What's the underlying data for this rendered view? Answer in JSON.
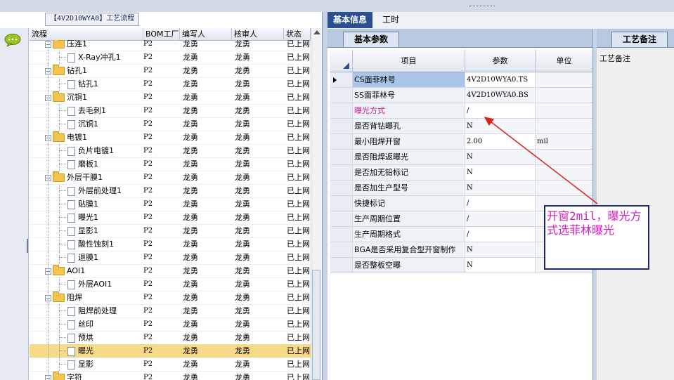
{
  "left_panel": {
    "process_title": "【4V2D10WYA0】工艺流程",
    "columns": [
      "流程",
      "BOM工厂",
      "编写人",
      "核审人",
      "状态"
    ],
    "rows": [
      {
        "name": "压连1",
        "type": "folder",
        "bom": "P2",
        "author": "龙勇",
        "reviewer": "龙勇",
        "status": "已上网"
      },
      {
        "name": "X-Ray冲孔1",
        "type": "doc",
        "bom": "P2",
        "author": "龙勇",
        "reviewer": "龙勇",
        "status": "已上网"
      },
      {
        "name": "钻孔1",
        "type": "folder",
        "bom": "P2",
        "author": "龙勇",
        "reviewer": "龙勇",
        "status": "已上网"
      },
      {
        "name": "钻孔1",
        "type": "doc",
        "bom": "P2",
        "author": "龙勇",
        "reviewer": "龙勇",
        "status": "已上网"
      },
      {
        "name": "沉铜1",
        "type": "folder",
        "bom": "P2",
        "author": "龙勇",
        "reviewer": "龙勇",
        "status": "已上网"
      },
      {
        "name": "去毛刺1",
        "type": "doc",
        "bom": "P2",
        "author": "龙勇",
        "reviewer": "龙勇",
        "status": "已上网"
      },
      {
        "name": "沉铜1",
        "type": "doc",
        "bom": "P2",
        "author": "龙勇",
        "reviewer": "龙勇",
        "status": "已上网"
      },
      {
        "name": "电镀1",
        "type": "folder",
        "bom": "P2",
        "author": "龙勇",
        "reviewer": "龙勇",
        "status": "已上网"
      },
      {
        "name": "负片电镀1",
        "type": "doc",
        "bom": "P2",
        "author": "龙勇",
        "reviewer": "龙勇",
        "status": "已上网"
      },
      {
        "name": "磨板1",
        "type": "doc",
        "bom": "P2",
        "author": "龙勇",
        "reviewer": "龙勇",
        "status": "已上网"
      },
      {
        "name": "外层干膜1",
        "type": "folder",
        "bom": "P2",
        "author": "龙勇",
        "reviewer": "龙勇",
        "status": "已上网"
      },
      {
        "name": "外层前处理1",
        "type": "doc",
        "bom": "P2",
        "author": "龙勇",
        "reviewer": "龙勇",
        "status": "已上网"
      },
      {
        "name": "贴膜1",
        "type": "doc",
        "bom": "P2",
        "author": "龙勇",
        "reviewer": "龙勇",
        "status": "已上网"
      },
      {
        "name": "曝光1",
        "type": "doc",
        "bom": "P2",
        "author": "龙勇",
        "reviewer": "龙勇",
        "status": "已上网"
      },
      {
        "name": "显影1",
        "type": "doc",
        "bom": "P2",
        "author": "龙勇",
        "reviewer": "龙勇",
        "status": "已上网"
      },
      {
        "name": "酸性蚀刻1",
        "type": "doc",
        "bom": "P2",
        "author": "龙勇",
        "reviewer": "龙勇",
        "status": "已上网"
      },
      {
        "name": "退膜1",
        "type": "doc",
        "bom": "P2",
        "author": "龙勇",
        "reviewer": "龙勇",
        "status": "已上网"
      },
      {
        "name": "AOI1",
        "type": "folder",
        "bom": "P2",
        "author": "龙勇",
        "reviewer": "龙勇",
        "status": "已上网"
      },
      {
        "name": "外层AOI1",
        "type": "doc",
        "bom": "P2",
        "author": "龙勇",
        "reviewer": "龙勇",
        "status": "已上网"
      },
      {
        "name": "阻焊",
        "type": "folder",
        "bom": "P2",
        "author": "龙勇",
        "reviewer": "龙勇",
        "status": "已上网"
      },
      {
        "name": "阻焊前处理",
        "type": "doc",
        "bom": "P2",
        "author": "龙勇",
        "reviewer": "龙勇",
        "status": "已上网"
      },
      {
        "name": "丝印",
        "type": "doc",
        "bom": "P2",
        "author": "龙勇",
        "reviewer": "龙勇",
        "status": "已上网"
      },
      {
        "name": "预烘",
        "type": "doc",
        "bom": "P2",
        "author": "龙勇",
        "reviewer": "龙勇",
        "status": "已上网"
      },
      {
        "name": "曝光",
        "type": "doc",
        "bom": "P2",
        "author": "龙勇",
        "reviewer": "龙勇",
        "status": "已上网",
        "selected": true
      },
      {
        "name": "显影",
        "type": "doc",
        "bom": "P2",
        "author": "龙勇",
        "reviewer": "龙勇",
        "status": "已上网"
      },
      {
        "name": "字符",
        "type": "folder",
        "bom": "P2",
        "author": "龙勇",
        "reviewer": "龙勇",
        "status": "已上网"
      }
    ]
  },
  "tabs": {
    "main": [
      "基本信息",
      "工时"
    ],
    "sub": "基本参数",
    "notes_tab": "工艺备注"
  },
  "param_table": {
    "headers": [
      "项目",
      "参数",
      "单位"
    ],
    "rows": [
      {
        "item": "CS面菲林号",
        "value": "4V2D10WYA0.TS",
        "unit": "",
        "current": true
      },
      {
        "item": "SS面菲林号",
        "value": "4V2D10WYA0.BS",
        "unit": ""
      },
      {
        "item": "曝光方式",
        "value": "/",
        "unit": "",
        "pink": true
      },
      {
        "item": "是否背钻曝孔",
        "value": "N",
        "unit": ""
      },
      {
        "item": "最小阻焊开窗",
        "value": "2.00",
        "unit": "mil"
      },
      {
        "item": "是否阻焊返曝光",
        "value": "N",
        "unit": ""
      },
      {
        "item": "是否加无铅标记",
        "value": "N",
        "unit": ""
      },
      {
        "item": "是否加生产型号",
        "value": "N",
        "unit": ""
      },
      {
        "item": "快捷标记",
        "value": "/",
        "unit": ""
      },
      {
        "item": "生产周期位置",
        "value": "/",
        "unit": ""
      },
      {
        "item": "生产周期格式",
        "value": "/",
        "unit": ""
      },
      {
        "item": "BGA是否采用复合型开窗制作",
        "value": "N",
        "unit": ""
      },
      {
        "item": "是否整板空曝",
        "value": "N",
        "unit": ""
      }
    ]
  },
  "notes": {
    "label": "工艺备注"
  },
  "annotation": {
    "text": "开窗2mil，曝光方式选菲林曝光"
  },
  "colors": {
    "selected_row": "#f7d98a",
    "tab_active": "#2b4f90",
    "annotation_text": "#cf1fb8",
    "arrow": "#e02020"
  }
}
